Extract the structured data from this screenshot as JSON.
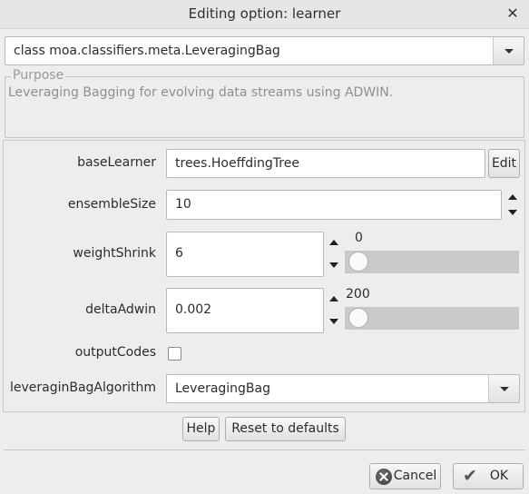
{
  "window": {
    "title": "Editing option: learner",
    "close_glyph": "✕"
  },
  "class_selector": {
    "value": "class moa.classifiers.meta.LeveragingBag"
  },
  "purpose": {
    "title": "Purpose",
    "text": "Leveraging Bagging for evolving data streams using ADWIN."
  },
  "options": {
    "baseLearner": {
      "label": "baseLearner",
      "value": "trees.HoeffdingTree",
      "edit_label": "Edit"
    },
    "ensembleSize": {
      "label": "ensembleSize",
      "value": "10"
    },
    "weightShrink": {
      "label": "weightShrink",
      "value": "6",
      "slider_label": "0",
      "slider_level": 0
    },
    "deltaAdwin": {
      "label": "deltaAdwin",
      "value": "0.002",
      "slider_label": "200",
      "slider_level": 0
    },
    "outputCodes": {
      "label": "outputCodes",
      "checked": false
    },
    "leveraginBagAlgorithm": {
      "label": "leveraginBagAlgorithm",
      "value": "LeveragingBag"
    }
  },
  "buttons": {
    "help": "Help",
    "reset": "Reset to defaults",
    "cancel": "Cancel",
    "ok": "OK"
  },
  "icons": {
    "close": "close-icon",
    "dropdown": "chevron-down-icon",
    "cancel": "cancel-icon",
    "ok": "checkmark-icon"
  }
}
